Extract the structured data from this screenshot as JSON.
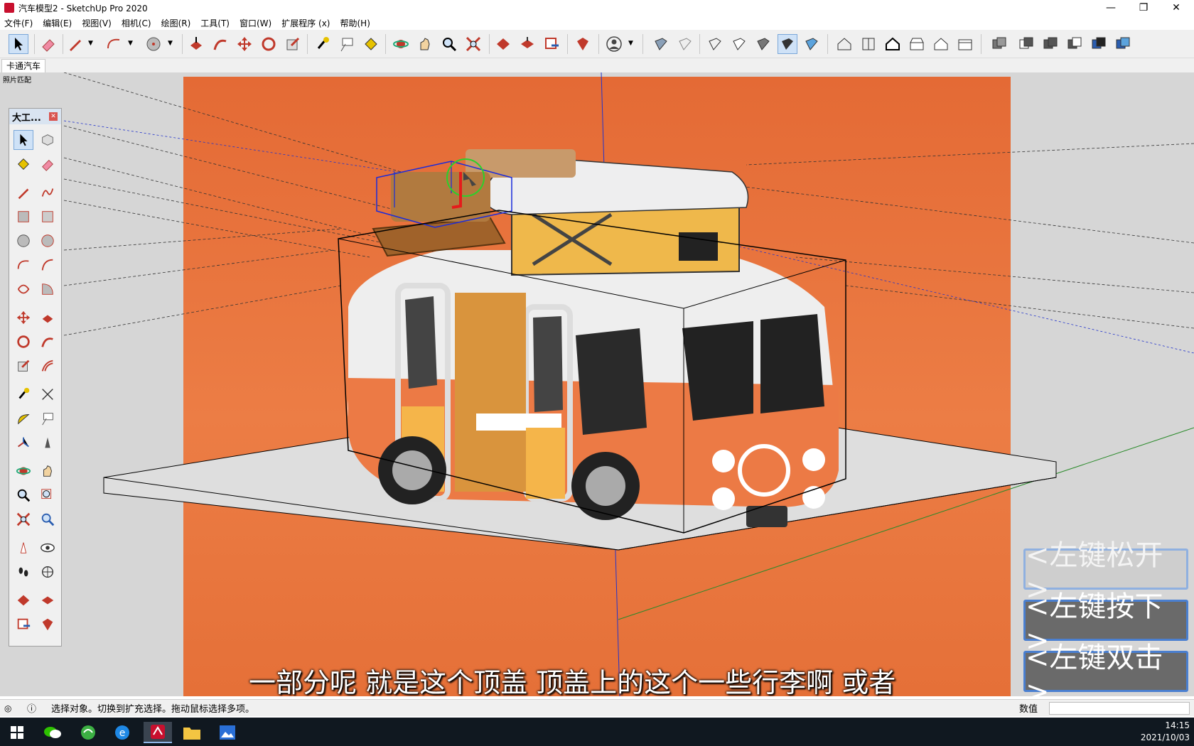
{
  "window": {
    "title": "汽车模型2 - SketchUp Pro 2020"
  },
  "menu": [
    "文件(F)",
    "编辑(E)",
    "视图(V)",
    "相机(C)",
    "绘图(R)",
    "工具(T)",
    "窗口(W)",
    "扩展程序 (x)",
    "帮助(H)"
  ],
  "scene_tab": "卡通汽车",
  "viewport": {
    "match_photo_label": "照片匹配"
  },
  "palette": {
    "title": "大工..."
  },
  "subtitle": "一部分呢 就是这个顶盖 顶盖上的这个一些行李啊 或者",
  "mouse_overlay": {
    "release": "<左键松开>",
    "press": "<左键按下>",
    "double": "<左键双击>"
  },
  "status": {
    "text": "选择对象。切换到扩充选择。拖动鼠标选择多项。",
    "vcb_label": "数值"
  },
  "clock": {
    "time": "14:15",
    "date": "2021/10/03"
  },
  "colors": {
    "accent": "#4a7fd0",
    "photo_bg": "#e46a35",
    "taskbar": "#101820"
  }
}
